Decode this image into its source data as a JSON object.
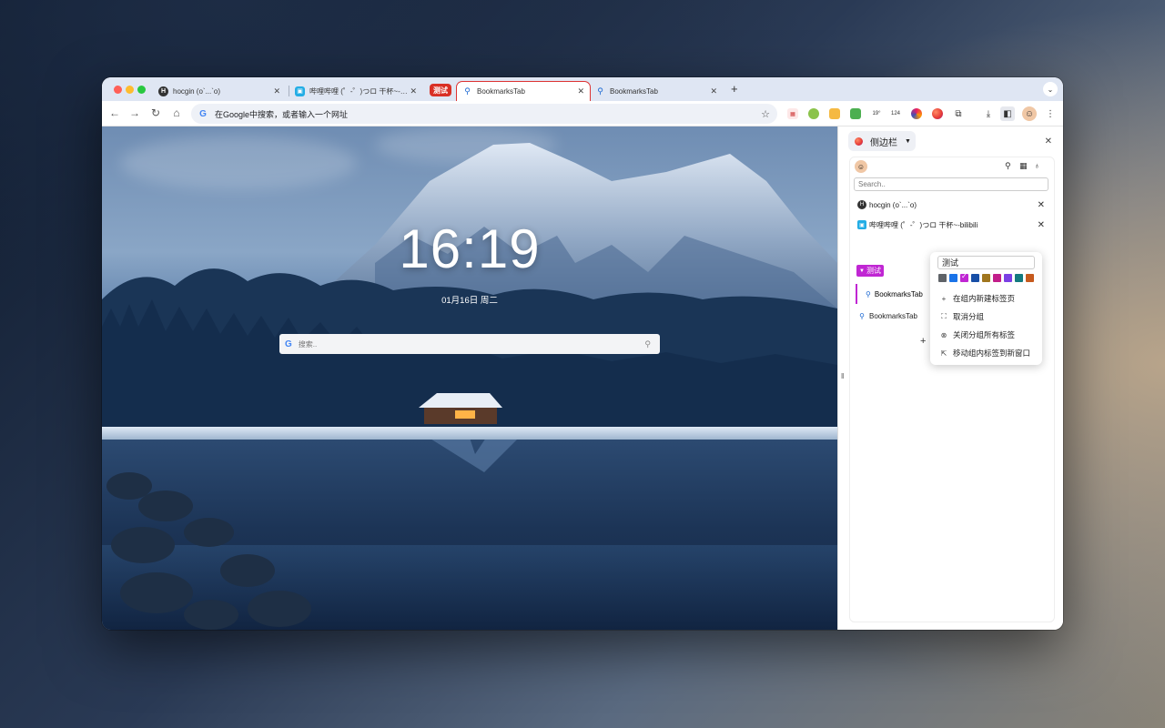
{
  "tabs": [
    {
      "title": "hocgin (o`...`o)",
      "icon": "hocgin-favicon"
    },
    {
      "title": "哔哩哔哩 (゜-゜)つロ 干杯~-bili",
      "icon": "bilibili-favicon"
    },
    {
      "title": "BookmarksTab",
      "icon": "search-favicon",
      "active": true
    },
    {
      "title": "BookmarksTab",
      "icon": "search-favicon"
    }
  ],
  "tab_group": {
    "label": "测试",
    "color": "#d93025"
  },
  "address_bar": {
    "placeholder": "在Google中搜索，或者输入一个网址"
  },
  "extensions": [
    "ext-1",
    "ext-2",
    "ext-3",
    "ext-4",
    "ext-5",
    "ext-6",
    "ext-7",
    "ext-8"
  ],
  "ext_badges": {
    "weather": "19°",
    "counter": "124"
  },
  "newtab": {
    "time": "16:19",
    "date": "01月16日 周二",
    "search_placeholder": "搜索.."
  },
  "sidepanel": {
    "title": "侧边栏",
    "search_placeholder": "Search..",
    "items": [
      {
        "label": "hocgin (o`...`o)"
      },
      {
        "label": "哔哩哔哩 (゜-゜)つロ 干杯~-bilibili"
      }
    ],
    "group": {
      "label": "测试",
      "color": "#c026d3",
      "tabs": [
        "BookmarksTab"
      ]
    },
    "loose_tab": "BookmarksTab",
    "add_label": "+"
  },
  "context_menu": {
    "group_name": "测试",
    "colors": [
      "#5f6368",
      "#1a73e8",
      "#c026d3",
      "#174ea6",
      "#a0761e",
      "#c21e8a",
      "#7b3fe4",
      "#137a7f",
      "#c65a1e"
    ],
    "selected_color": 2,
    "items": [
      {
        "icon": "plus-icon",
        "glyph": "+",
        "label": "在组内新建标签页"
      },
      {
        "icon": "ungroup-icon",
        "glyph": "⛶",
        "label": "取消分组"
      },
      {
        "icon": "close-circle-icon",
        "glyph": "⊗",
        "label": "关闭分组所有标签"
      },
      {
        "icon": "move-window-icon",
        "glyph": "⇱",
        "label": "移动组内标签到新窗口"
      }
    ]
  }
}
